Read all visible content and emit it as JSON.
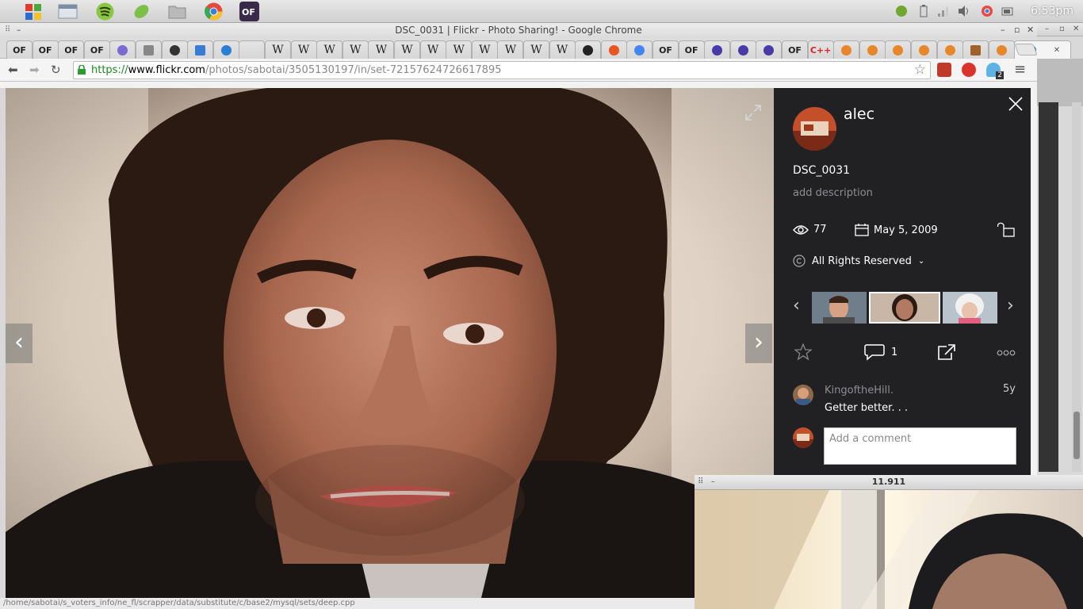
{
  "desktop": {
    "clock": "6:53pm",
    "launchers": [
      "windows-icon",
      "files-icon",
      "spotify-icon",
      "leaf-icon",
      "folder-icon",
      "chrome-icon",
      "app-icon"
    ],
    "tray": [
      "spotify-tray-icon",
      "battery-icon",
      "signal-icon",
      "volume-icon",
      "chrome-tray-icon",
      "power-icon"
    ]
  },
  "browser": {
    "title": "DSC_0031 | Flickr - Photo Sharing! - Google Chrome",
    "url_scheme": "https://",
    "url_host": "www.flickr.com",
    "url_path": "/photos/sabotai/3505130197/in/set-72157624726617895",
    "tabs": [
      "OF",
      "OF",
      "OF",
      "OF",
      "",
      "",
      "",
      "",
      "",
      "",
      "W",
      "W",
      "W",
      "W",
      "W",
      "W",
      "W",
      "W",
      "W",
      "W",
      "W",
      "W",
      "",
      "",
      "",
      "OF",
      "OF",
      "",
      "",
      "",
      "OF",
      "C++",
      "",
      "",
      "",
      "",
      "",
      "",
      "",
      ""
    ],
    "extension_badge": "2"
  },
  "photo_page": {
    "owner": "alec",
    "photo_title": "DSC_0031",
    "description_placeholder": "add description",
    "views": "77",
    "date_taken": "May 5, 2009",
    "license": "All Rights Reserved",
    "comment_count": "1",
    "comments": [
      {
        "user": "KingoftheHill.",
        "time": "5y",
        "text": "Getter better. . ."
      }
    ],
    "comment_placeholder": "Add a comment"
  },
  "status_text": "/home/sabotai/s_voters_info/ne_fl/scrapper/data/substitute/c/base2/mysql/sets/deep.cpp",
  "cam_window": {
    "title": "11.911"
  },
  "colors": {
    "panel_bg": "#212124",
    "url_green": "#1a8a1a"
  }
}
